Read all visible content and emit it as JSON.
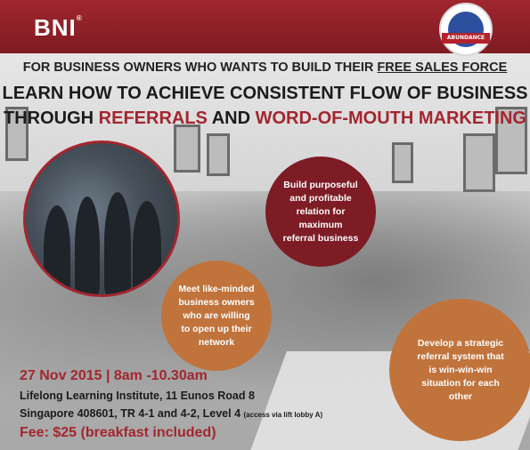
{
  "header": {
    "logo_text": "BNI",
    "logo_mark": "®",
    "badge_text": "ABUNDANCE"
  },
  "kicker": {
    "prefix": "FOR BUSINESS OWNERS WHO WANTS TO BUILD THEIR ",
    "underlined": "FREE SALES FORCE"
  },
  "headline": {
    "line1": "LEARN HOW TO ACHIEVE CONSISTENT FLOW OF BUSINESS",
    "line2_prefix": "THROUGH ",
    "line2_red1": "REFERRALS",
    "line2_mid": " AND ",
    "line2_red2": "WORD-OF-MOUTH MARKETING"
  },
  "bubbles": {
    "b1": "Build purposeful and profitable relation for maximum referral business",
    "b2": "Meet like-minded business owners who are willing to open up their network",
    "b3": "Develop a strategic referral system that is win-win-win situation for each other"
  },
  "event": {
    "date": "27 Nov 2015 | 8am -10.30am",
    "address1": "Lifelong Learning Institute, 11 Eunos Road 8",
    "address2": "Singapore 408601, TR 4-1 and 4-2, Level 4 ",
    "address_note": "(access via lift lobby A)",
    "fee": "Fee: $25 (breakfast included)"
  },
  "colors": {
    "brand_red": "#a3262f",
    "dark_red": "#7d1c24",
    "orange": "#c1733c"
  }
}
